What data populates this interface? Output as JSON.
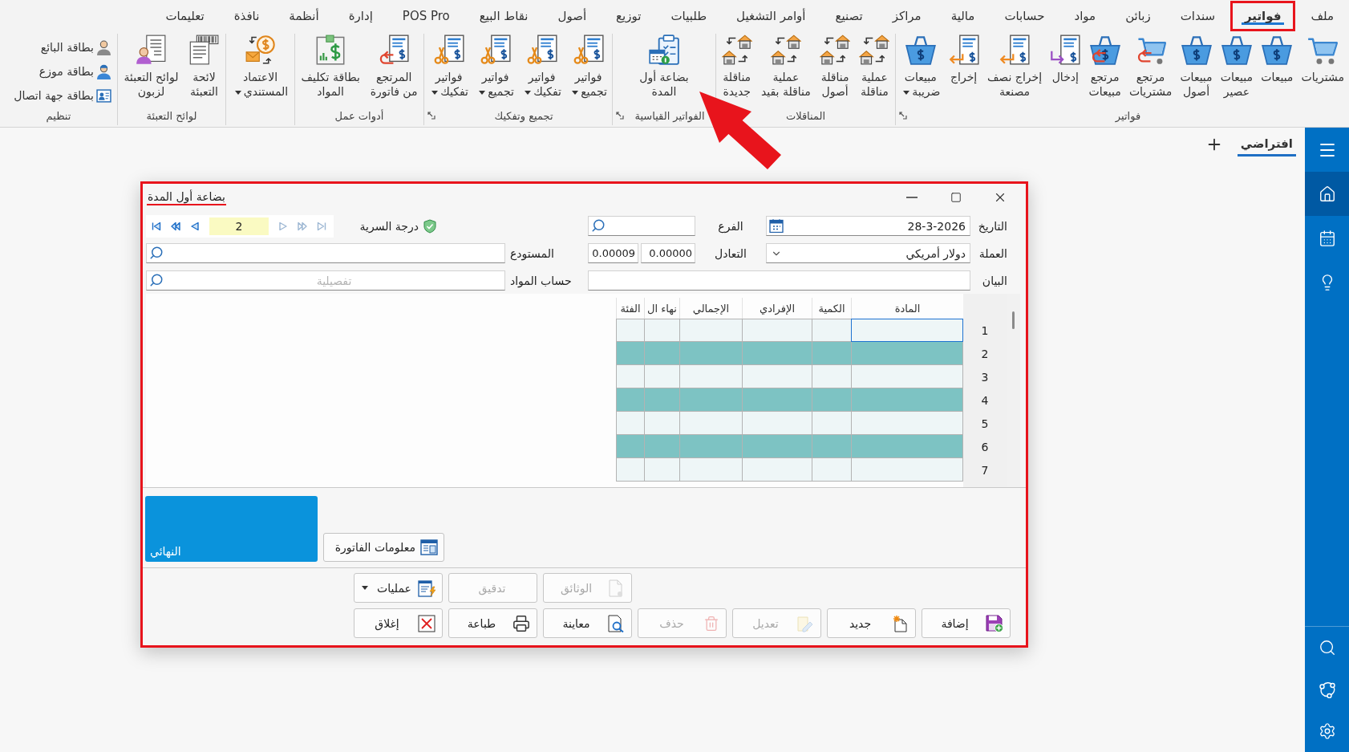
{
  "menu_bar": {
    "items": [
      {
        "label": "ملف",
        "selected": false,
        "highlighted": false
      },
      {
        "label": "فواتير",
        "selected": true,
        "highlighted": true
      },
      {
        "label": "سندات",
        "selected": false,
        "highlighted": false
      },
      {
        "label": "زبائن",
        "selected": false,
        "highlighted": false
      },
      {
        "label": "مواد",
        "selected": false,
        "highlighted": false
      },
      {
        "label": "حسابات",
        "selected": false,
        "highlighted": false
      },
      {
        "label": "مالية",
        "selected": false,
        "highlighted": false
      },
      {
        "label": "مراكز",
        "selected": false,
        "highlighted": false
      },
      {
        "label": "تصنيع",
        "selected": false,
        "highlighted": false
      },
      {
        "label": "أوامر التشغيل",
        "selected": false,
        "highlighted": false
      },
      {
        "label": "طلبيات",
        "selected": false,
        "highlighted": false
      },
      {
        "label": "توزيع",
        "selected": false,
        "highlighted": false
      },
      {
        "label": "أصول",
        "selected": false,
        "highlighted": false
      },
      {
        "label": "نقاط البيع",
        "selected": false,
        "highlighted": false
      },
      {
        "label": "POS Pro",
        "selected": false,
        "highlighted": false
      },
      {
        "label": "إدارة",
        "selected": false,
        "highlighted": false
      },
      {
        "label": "أنظمة",
        "selected": false,
        "highlighted": false
      },
      {
        "label": "نافذة",
        "selected": false,
        "highlighted": false
      },
      {
        "label": "تعليمات",
        "selected": false,
        "highlighted": false
      }
    ]
  },
  "ribbon": {
    "groups": [
      {
        "label": "فواتير",
        "kind": "large",
        "launcher": true,
        "buttons": [
          {
            "label": "مشتريات",
            "has_menu": false
          },
          {
            "label": "مبيعات",
            "has_menu": false
          },
          {
            "label": "مبيعات\nعصير",
            "has_menu": false
          },
          {
            "label": "مبيعات\nأصول",
            "has_menu": false
          },
          {
            "label": "مرتجع\nمشتريات",
            "has_menu": false
          },
          {
            "label": "مرتجع\nمبيعات",
            "has_menu": false
          },
          {
            "label": "إدخال",
            "has_menu": false
          },
          {
            "label": "إخراج نصف\nمصنعة",
            "has_menu": false
          },
          {
            "label": "إخراج",
            "has_menu": false
          },
          {
            "label": "مبيعات\nضريبة",
            "has_menu": true
          }
        ]
      },
      {
        "label": "المناقلات",
        "kind": "large",
        "launcher": false,
        "buttons": [
          {
            "label": "عملية\nمناقلة",
            "has_menu": false
          },
          {
            "label": "مناقلة\nأصول",
            "has_menu": false
          },
          {
            "label": "عملية\nمناقلة بقيد",
            "has_menu": false
          },
          {
            "label": "مناقلة\nجديدة",
            "has_menu": false
          }
        ]
      },
      {
        "label": "الفواتير القياسية",
        "kind": "large",
        "launcher": true,
        "buttons": [
          {
            "label": "بضاعة أول\nالمدة",
            "has_menu": false
          }
        ]
      },
      {
        "label": "تجميع وتفكيك",
        "kind": "large",
        "launcher": true,
        "buttons": [
          {
            "label": "فواتير\nتجميع",
            "has_menu": true
          },
          {
            "label": "فواتير\nتفكيك",
            "has_menu": true
          },
          {
            "label": "فواتير\nتجميع",
            "has_menu": true
          },
          {
            "label": "فواتير\nتفكيك",
            "has_menu": true
          }
        ]
      },
      {
        "label": "أدوات عمل",
        "kind": "large",
        "launcher": false,
        "buttons": [
          {
            "label": "المرتجع\nمن فاتورة",
            "has_menu": false
          },
          {
            "label": "بطاقة تكليف\nالمواد",
            "has_menu": false
          }
        ]
      },
      {
        "kind": "large",
        "launcher": false,
        "buttons": [
          {
            "label": "الاعتماد\nالمستندي",
            "has_menu": true
          }
        ]
      },
      {
        "label": "لوائح التعبئة",
        "kind": "large",
        "launcher": false,
        "buttons": [
          {
            "label": "لائحة\nالتعبئة",
            "has_menu": false
          },
          {
            "label": "لوائح التعبئة\nلزبون",
            "has_menu": false
          }
        ]
      },
      {
        "label": "تنظيم",
        "kind": "small",
        "launcher": false,
        "buttons": [
          {
            "label": "بطاقة البائع",
            "has_menu": false
          },
          {
            "label": "بطاقة موزع",
            "has_menu": false
          },
          {
            "label": "بطاقة جهة اتصال",
            "has_menu": false
          }
        ]
      }
    ]
  },
  "tab_bar": {
    "tabs": [
      {
        "label": "افتراضي",
        "selected": true
      }
    ]
  },
  "sidebar": {
    "items": [
      {
        "selected": true
      },
      {
        "selected": false
      },
      {
        "selected": false
      }
    ]
  },
  "pointer_arrow": true,
  "dialog": {
    "title": "بضاعة أول المدة",
    "highlighted": true,
    "title_underlined": true,
    "form": {
      "date": {
        "label": "التاريخ",
        "value": "28-3-2026"
      },
      "branch": {
        "label": "الفرع"
      },
      "confidentiality": {
        "label": "درجة السرية"
      },
      "record_nav": {
        "value": "2",
        "buttons": [
          {
            "disabled": true
          },
          {
            "disabled": true
          },
          {
            "disabled": true
          },
          {
            "disabled": false
          },
          {
            "disabled": false
          },
          {
            "disabled": false
          }
        ]
      },
      "currency": {
        "label": "العملة",
        "value": "دولار أمريكي"
      },
      "exchange_rate": {
        "label": "التعادل",
        "values": [
          "0.00000",
          "0.00009"
        ]
      },
      "warehouse": {
        "label": "المستودع"
      },
      "statement": {
        "label": "البيان"
      },
      "materials_account": {
        "label": "حساب المواد",
        "placeholder": "تفصيلية"
      }
    },
    "grid": {
      "columns": [
        "المادة",
        "الكمية",
        "الإفرادي",
        "الإجمالي",
        "نهاء ال",
        "الفئة"
      ],
      "rows": [
        {
          "number": "1",
          "selected": true
        },
        {
          "number": "2",
          "selected": false
        },
        {
          "number": "3",
          "selected": false
        },
        {
          "number": "4",
          "selected": false
        },
        {
          "number": "5",
          "selected": false
        },
        {
          "number": "6",
          "selected": false
        },
        {
          "number": "7",
          "selected": false
        }
      ]
    },
    "total_panel": {
      "label": "النهائي"
    },
    "info_button": {
      "label": "معلومات الفاتورة"
    },
    "actions": [
      {
        "buttons": [
          {
            "label": "الوثائق",
            "disabled": true,
            "has_menu": false
          },
          {
            "label": "تدقيق",
            "disabled": true,
            "has_menu": false
          },
          {
            "label": "عمليات",
            "disabled": false,
            "has_menu": true
          }
        ]
      },
      {
        "buttons": [
          {
            "label": "إضافة",
            "disabled": false,
            "has_menu": false
          },
          {
            "label": "جديد",
            "disabled": false,
            "has_menu": false
          },
          {
            "label": "تعديل",
            "disabled": true,
            "has_menu": false
          },
          {
            "label": "حذف",
            "disabled": true,
            "has_menu": false
          },
          {
            "label": "معاينة",
            "disabled": false,
            "has_menu": false
          },
          {
            "label": "طباعة",
            "disabled": false,
            "has_menu": false
          },
          {
            "label": "إغلاق",
            "disabled": false,
            "has_menu": false
          }
        ]
      }
    ]
  }
}
